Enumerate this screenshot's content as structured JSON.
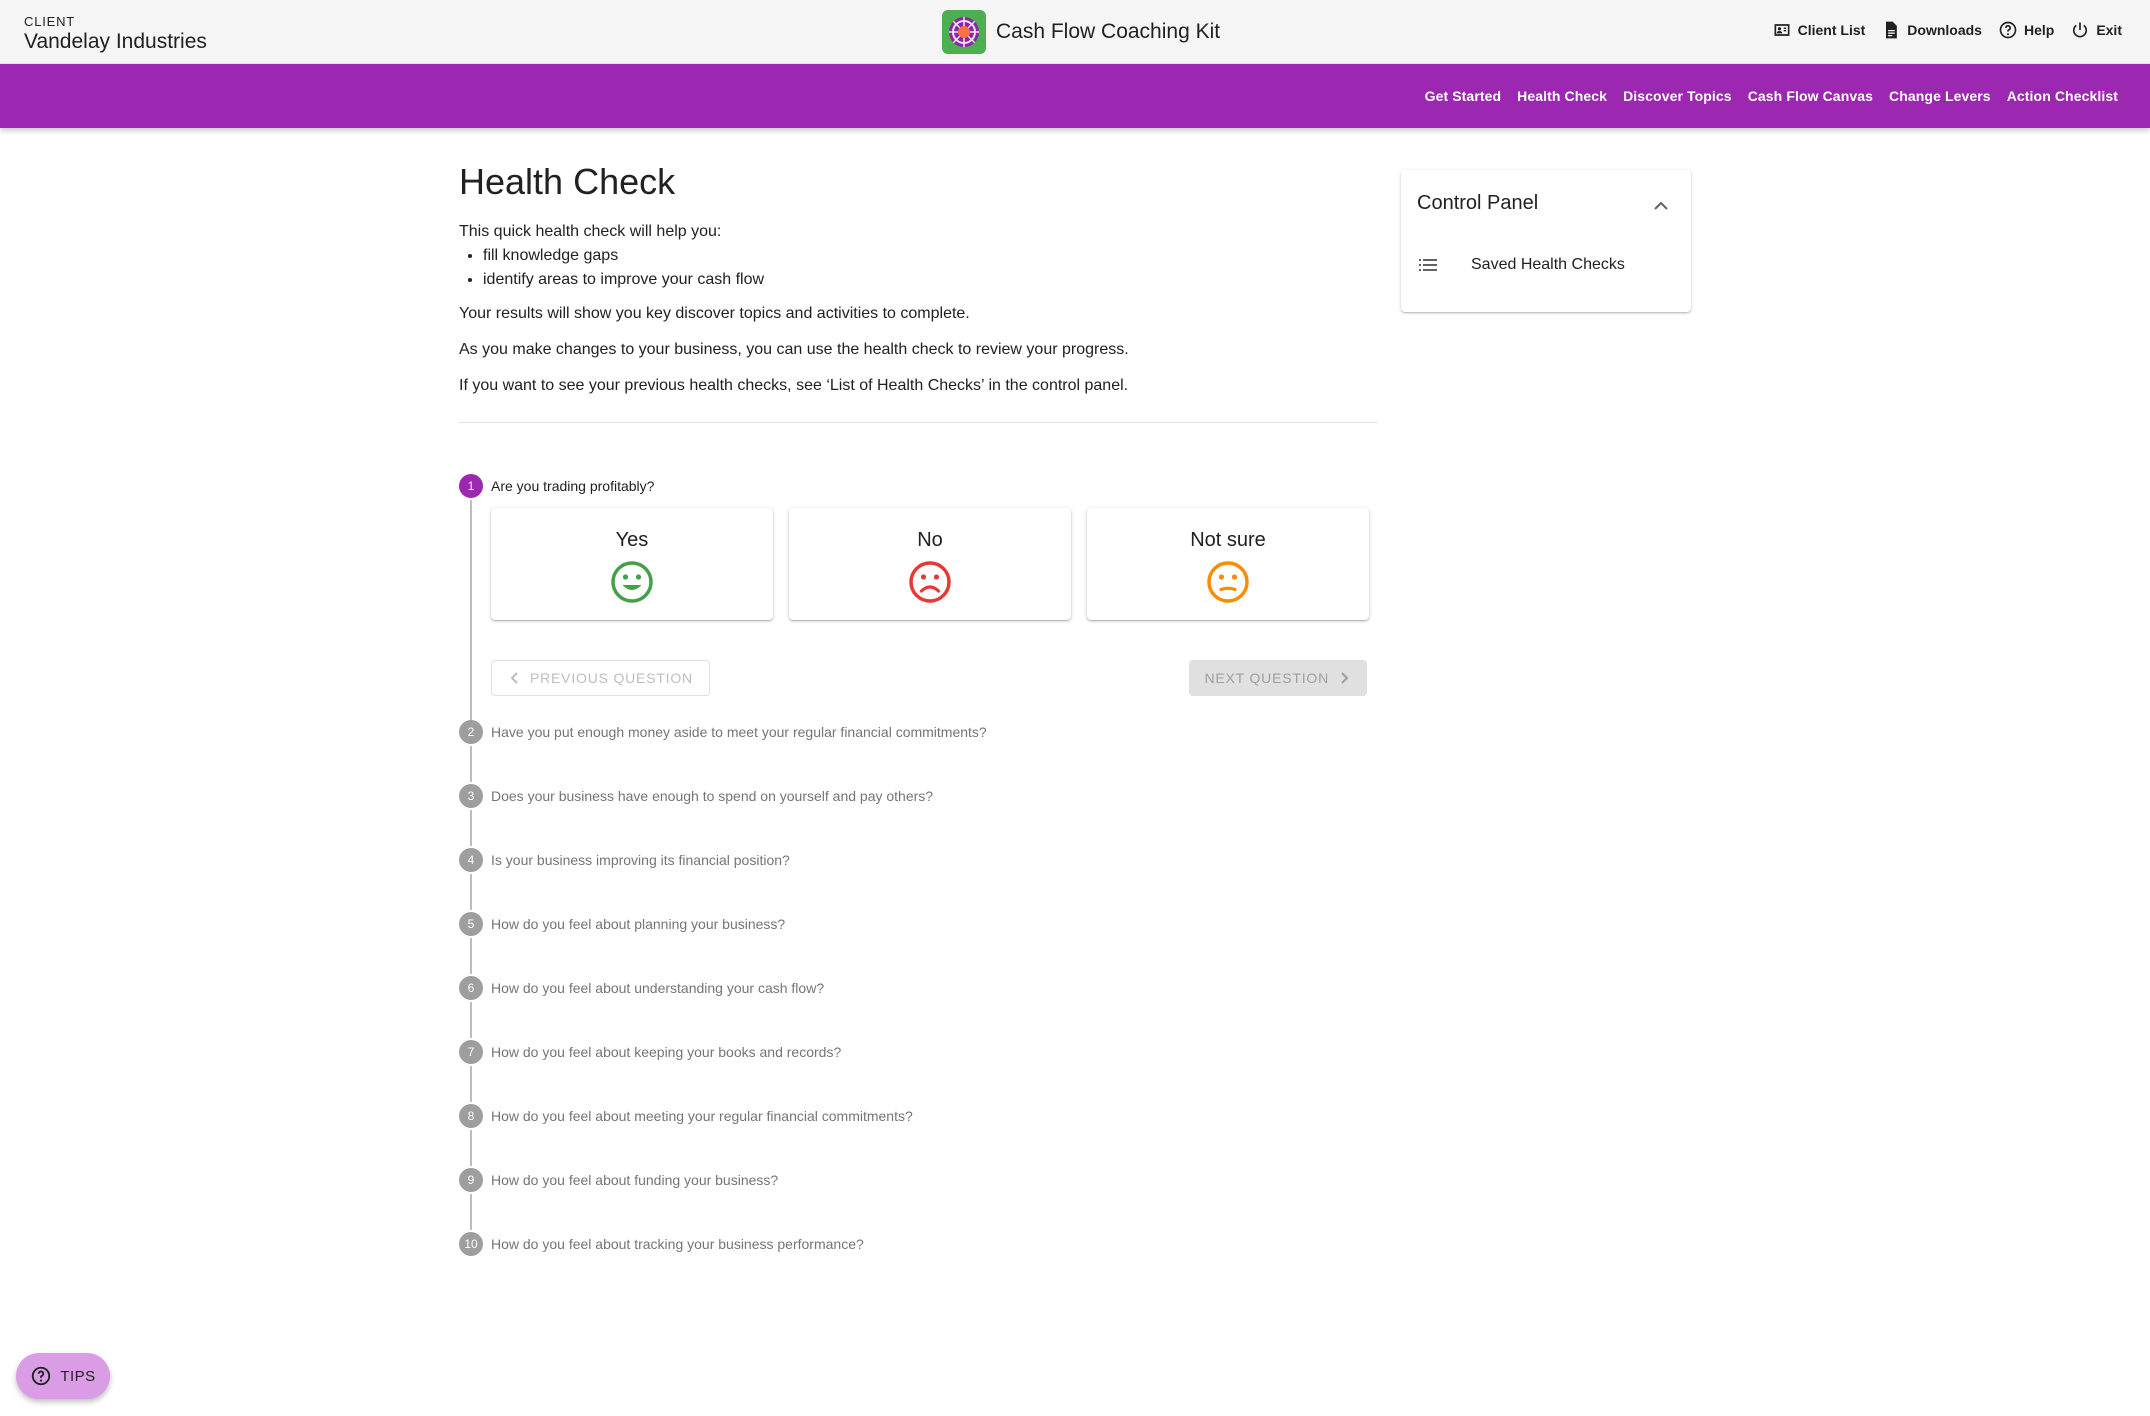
{
  "client": {
    "caption": "CLIENT",
    "name": "Vandelay Industries"
  },
  "app": {
    "title": "Cash Flow Coaching Kit"
  },
  "top_actions": [
    {
      "label": "Client List",
      "icon": "contact-card-icon"
    },
    {
      "label": "Downloads",
      "icon": "document-icon"
    },
    {
      "label": "Help",
      "icon": "help-circle-icon"
    },
    {
      "label": "Exit",
      "icon": "power-icon"
    }
  ],
  "nav": {
    "items": [
      {
        "label": "Get Started"
      },
      {
        "label": "Health Check"
      },
      {
        "label": "Discover Topics"
      },
      {
        "label": "Cash Flow Canvas"
      },
      {
        "label": "Change Levers"
      },
      {
        "label": "Action Checklist"
      }
    ]
  },
  "main": {
    "title": "Health Check",
    "intro": "This quick health check will help you:",
    "bullets": [
      "fill knowledge gaps",
      "identify areas to improve your cash flow"
    ],
    "paragraphs": [
      "Your results will show you key discover topics and activities to complete.",
      "As you make changes to your business, you can use the health check to review your progress.",
      "If you want to see your previous health checks, see ‘List of Health Checks’ in the control panel."
    ]
  },
  "questions": [
    {
      "num": "1",
      "text": "Are you trading profitably?"
    },
    {
      "num": "2",
      "text": "Have you put enough money aside to meet your regular financial commitments?"
    },
    {
      "num": "3",
      "text": "Does your business have enough to spend on yourself and pay others?"
    },
    {
      "num": "4",
      "text": "Is your business improving its financial position?"
    },
    {
      "num": "5",
      "text": "How do you feel about planning your business?"
    },
    {
      "num": "6",
      "text": "How do you feel about understanding your cash flow?"
    },
    {
      "num": "7",
      "text": "How do you feel about keeping your books and records?"
    },
    {
      "num": "8",
      "text": "How do you feel about meeting your regular financial commitments?"
    },
    {
      "num": "9",
      "text": "How do you feel about funding your business?"
    },
    {
      "num": "10",
      "text": "How do you feel about tracking your business performance?"
    }
  ],
  "answers": [
    {
      "label": "Yes",
      "icon": "happy-face-icon",
      "color": "#43a047"
    },
    {
      "label": "No",
      "icon": "sad-face-icon",
      "color": "#e53935"
    },
    {
      "label": "Not sure",
      "icon": "unsure-face-icon",
      "color": "#fb8c00"
    }
  ],
  "step_nav": {
    "previous": "PREVIOUS QUESTION",
    "next": "NEXT QUESTION"
  },
  "control_panel": {
    "title": "Control Panel",
    "items": [
      {
        "label": "Saved Health Checks",
        "icon": "list-icon"
      }
    ]
  },
  "tips": {
    "label": "TIPS"
  },
  "colors": {
    "primary": "#9c27b0",
    "topbar": "#f5f5f5",
    "tips": "#d99ce5"
  }
}
